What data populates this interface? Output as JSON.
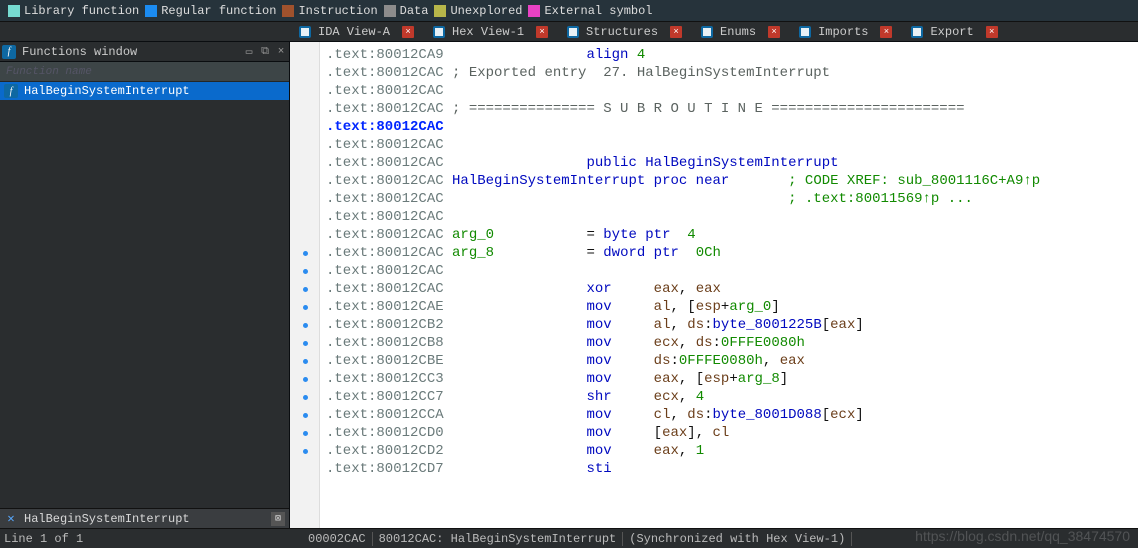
{
  "legend": [
    {
      "color": "#76dbd1",
      "label": "Library function"
    },
    {
      "color": "#1b8cf2",
      "label": "Regular function"
    },
    {
      "color": "#a0522d",
      "label": "Instruction"
    },
    {
      "color": "#8c8c8c",
      "label": "Data"
    },
    {
      "color": "#b6b64a",
      "label": "Unexplored"
    },
    {
      "color": "#e842c4",
      "label": "External symbol"
    }
  ],
  "functions_window": {
    "title": "Functions window",
    "filter_placeholder": "Function name",
    "items": [
      {
        "name": "HalBeginSystemInterrupt",
        "selected": true
      }
    ],
    "footer_text": "HalBeginSystemInterrupt"
  },
  "tabs": [
    {
      "icon": "ida",
      "label": "IDA View-A"
    },
    {
      "icon": "hex",
      "label": "Hex View-1"
    },
    {
      "icon": "struct",
      "label": "Structures"
    },
    {
      "icon": "enum",
      "label": "Enums"
    },
    {
      "icon": "import",
      "label": "Imports"
    },
    {
      "icon": "export",
      "label": "Export"
    }
  ],
  "status": {
    "left": "Line 1 of 1",
    "segs": [
      "00002CAC",
      "80012CAC: HalBeginSystemInterrupt",
      "(Synchronized with Hex View-1)"
    ]
  },
  "watermark": "https://blog.csdn.net/qq_38474570",
  "code": {
    "dot_rows": [
      11,
      12,
      13,
      14,
      15,
      16,
      17,
      18,
      19,
      20,
      21,
      22
    ],
    "lines": [
      {
        "addr": ".text:80012CA9",
        "addrcls": "addr",
        "segs": [
          {
            "t": "                 ",
            "c": ""
          },
          {
            "t": "align ",
            "c": "kw"
          },
          {
            "t": "4",
            "c": "num"
          }
        ]
      },
      {
        "addr": ".text:80012CAC",
        "addrcls": "addr",
        "segs": [
          {
            "t": " ; Exported entry  27. HalBeginSystemInterrupt",
            "c": "cmt"
          }
        ]
      },
      {
        "addr": ".text:80012CAC",
        "addrcls": "addr",
        "segs": []
      },
      {
        "addr": ".text:80012CAC",
        "addrcls": "addr",
        "segs": [
          {
            "t": " ; =============== S U B R O U T I N E =======================",
            "c": "cmt"
          }
        ]
      },
      {
        "addr": ".text:80012CAC",
        "addrcls": "addr-blue",
        "segs": []
      },
      {
        "addr": ".text:80012CAC",
        "addrcls": "addr",
        "segs": []
      },
      {
        "addr": ".text:80012CAC",
        "addrcls": "addr",
        "segs": [
          {
            "t": "                 ",
            "c": ""
          },
          {
            "t": "public ",
            "c": "kw"
          },
          {
            "t": "HalBeginSystemInterrupt",
            "c": "kw"
          }
        ]
      },
      {
        "addr": ".text:80012CAC",
        "addrcls": "addr",
        "segs": [
          {
            "t": " ",
            "c": ""
          },
          {
            "t": "HalBeginSystemInterrupt ",
            "c": "kw"
          },
          {
            "t": "proc near",
            "c": "kw"
          },
          {
            "t": "       ",
            "c": ""
          },
          {
            "t": "; CODE XREF: sub_8001116C+A9↑p",
            "c": "upref"
          }
        ]
      },
      {
        "addr": ".text:80012CAC",
        "addrcls": "addr",
        "segs": [
          {
            "t": "                                         ",
            "c": ""
          },
          {
            "t": "; .text:80011569↑p ...",
            "c": "upref"
          }
        ]
      },
      {
        "addr": ".text:80012CAC",
        "addrcls": "addr",
        "segs": []
      },
      {
        "addr": ".text:80012CAC",
        "addrcls": "addr",
        "segs": [
          {
            "t": " ",
            "c": ""
          },
          {
            "t": "arg_0",
            "c": "ident"
          },
          {
            "t": "           = ",
            "c": ""
          },
          {
            "t": "byte ptr",
            "c": "kw"
          },
          {
            "t": "  ",
            "c": ""
          },
          {
            "t": "4",
            "c": "num"
          }
        ]
      },
      {
        "addr": ".text:80012CAC",
        "addrcls": "addr",
        "segs": [
          {
            "t": " ",
            "c": ""
          },
          {
            "t": "arg_8",
            "c": "ident"
          },
          {
            "t": "           = ",
            "c": ""
          },
          {
            "t": "dword ptr",
            "c": "kw"
          },
          {
            "t": "  ",
            "c": ""
          },
          {
            "t": "0Ch",
            "c": "num"
          }
        ]
      },
      {
        "addr": ".text:80012CAC",
        "addrcls": "addr",
        "segs": []
      },
      {
        "addr": ".text:80012CAC",
        "addrcls": "addr",
        "segs": [
          {
            "t": "                 ",
            "c": ""
          },
          {
            "t": "xor     ",
            "c": "kw"
          },
          {
            "t": "eax",
            "c": "op"
          },
          {
            "t": ", ",
            "c": ""
          },
          {
            "t": "eax",
            "c": "op"
          }
        ]
      },
      {
        "addr": ".text:80012CAE",
        "addrcls": "addr",
        "segs": [
          {
            "t": "                 ",
            "c": ""
          },
          {
            "t": "mov     ",
            "c": "kw"
          },
          {
            "t": "al",
            "c": "op"
          },
          {
            "t": ", [",
            "c": ""
          },
          {
            "t": "esp",
            "c": "op"
          },
          {
            "t": "+",
            "c": ""
          },
          {
            "t": "arg_0",
            "c": "ident"
          },
          {
            "t": "]",
            "c": ""
          }
        ]
      },
      {
        "addr": ".text:80012CB2",
        "addrcls": "addr",
        "segs": [
          {
            "t": "                 ",
            "c": ""
          },
          {
            "t": "mov     ",
            "c": "kw"
          },
          {
            "t": "al",
            "c": "op"
          },
          {
            "t": ", ",
            "c": ""
          },
          {
            "t": "ds",
            "c": "op"
          },
          {
            "t": ":",
            "c": ""
          },
          {
            "t": "byte_8001225B",
            "c": "kw"
          },
          {
            "t": "[",
            "c": ""
          },
          {
            "t": "eax",
            "c": "op"
          },
          {
            "t": "]",
            "c": ""
          }
        ]
      },
      {
        "addr": ".text:80012CB8",
        "addrcls": "addr",
        "segs": [
          {
            "t": "                 ",
            "c": ""
          },
          {
            "t": "mov     ",
            "c": "kw"
          },
          {
            "t": "ecx",
            "c": "op"
          },
          {
            "t": ", ",
            "c": ""
          },
          {
            "t": "ds",
            "c": "op"
          },
          {
            "t": ":",
            "c": ""
          },
          {
            "t": "0FFFE0080h",
            "c": "num"
          }
        ]
      },
      {
        "addr": ".text:80012CBE",
        "addrcls": "addr",
        "segs": [
          {
            "t": "                 ",
            "c": ""
          },
          {
            "t": "mov     ",
            "c": "kw"
          },
          {
            "t": "ds",
            "c": "op"
          },
          {
            "t": ":",
            "c": ""
          },
          {
            "t": "0FFFE0080h",
            "c": "num"
          },
          {
            "t": ", ",
            "c": ""
          },
          {
            "t": "eax",
            "c": "op"
          }
        ]
      },
      {
        "addr": ".text:80012CC3",
        "addrcls": "addr",
        "segs": [
          {
            "t": "                 ",
            "c": ""
          },
          {
            "t": "mov     ",
            "c": "kw"
          },
          {
            "t": "eax",
            "c": "op"
          },
          {
            "t": ", [",
            "c": ""
          },
          {
            "t": "esp",
            "c": "op"
          },
          {
            "t": "+",
            "c": ""
          },
          {
            "t": "arg_8",
            "c": "ident"
          },
          {
            "t": "]",
            "c": ""
          }
        ]
      },
      {
        "addr": ".text:80012CC7",
        "addrcls": "addr",
        "segs": [
          {
            "t": "                 ",
            "c": ""
          },
          {
            "t": "shr     ",
            "c": "kw"
          },
          {
            "t": "ecx",
            "c": "op"
          },
          {
            "t": ", ",
            "c": ""
          },
          {
            "t": "4",
            "c": "num"
          }
        ]
      },
      {
        "addr": ".text:80012CCA",
        "addrcls": "addr",
        "segs": [
          {
            "t": "                 ",
            "c": ""
          },
          {
            "t": "mov     ",
            "c": "kw"
          },
          {
            "t": "cl",
            "c": "op"
          },
          {
            "t": ", ",
            "c": ""
          },
          {
            "t": "ds",
            "c": "op"
          },
          {
            "t": ":",
            "c": ""
          },
          {
            "t": "byte_8001D088",
            "c": "kw"
          },
          {
            "t": "[",
            "c": ""
          },
          {
            "t": "ecx",
            "c": "op"
          },
          {
            "t": "]",
            "c": ""
          }
        ]
      },
      {
        "addr": ".text:80012CD0",
        "addrcls": "addr",
        "segs": [
          {
            "t": "                 ",
            "c": ""
          },
          {
            "t": "mov     ",
            "c": "kw"
          },
          {
            "t": "[",
            "c": ""
          },
          {
            "t": "eax",
            "c": "op"
          },
          {
            "t": "], ",
            "c": ""
          },
          {
            "t": "cl",
            "c": "op"
          }
        ]
      },
      {
        "addr": ".text:80012CD2",
        "addrcls": "addr",
        "segs": [
          {
            "t": "                 ",
            "c": ""
          },
          {
            "t": "mov     ",
            "c": "kw"
          },
          {
            "t": "eax",
            "c": "op"
          },
          {
            "t": ", ",
            "c": ""
          },
          {
            "t": "1",
            "c": "num"
          }
        ]
      },
      {
        "addr": ".text:80012CD7",
        "addrcls": "addr",
        "segs": [
          {
            "t": "                 ",
            "c": ""
          },
          {
            "t": "sti",
            "c": "kw"
          }
        ]
      }
    ]
  }
}
